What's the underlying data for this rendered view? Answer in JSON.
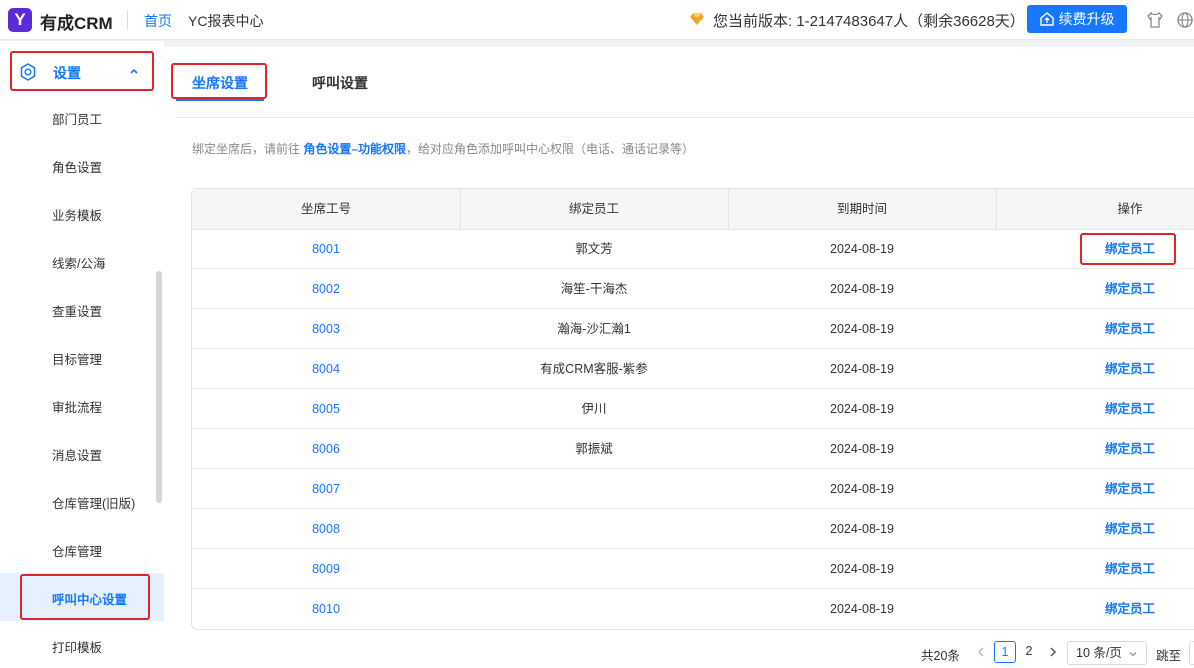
{
  "header": {
    "logo_letter": "Y",
    "brand": "有成CRM",
    "nav_home": "首页",
    "nav_report": "YC报表中心",
    "version_text": "您当前版本: 1-2147483647人（剩余36628天）",
    "upgrade_label": "续费升级",
    "accent": "#1677ff"
  },
  "sidebar": {
    "section_label": "设置",
    "items": [
      "部门员工",
      "角色设置",
      "业务模板",
      "线索/公海",
      "查重设置",
      "目标管理",
      "审批流程",
      "消息设置",
      "仓库管理(旧版)",
      "仓库管理",
      "呼叫中心设置",
      "打印模板"
    ],
    "active_item": "呼叫中心设置"
  },
  "tabs": {
    "seat": "坐席设置",
    "call": "呼叫设置"
  },
  "hint": {
    "prefix": "绑定坐席后，请前往",
    "link": "角色设置–功能权限",
    "suffix": "，给对应角色添加呼叫中心权限（电话、通话记录等）"
  },
  "table": {
    "headers": [
      "坐席工号",
      "绑定员工",
      "到期时间",
      "操作"
    ],
    "rows": [
      {
        "id": "8001",
        "employee": "郭文芳",
        "expire": "2024-08-19",
        "action": "绑定员工"
      },
      {
        "id": "8002",
        "employee": "海笙-干海杰",
        "expire": "2024-08-19",
        "action": "绑定员工"
      },
      {
        "id": "8003",
        "employee": "瀚海-沙汇瀚1",
        "expire": "2024-08-19",
        "action": "绑定员工"
      },
      {
        "id": "8004",
        "employee": "有成CRM客服-紫参",
        "expire": "2024-08-19",
        "action": "绑定员工"
      },
      {
        "id": "8005",
        "employee": "伊川",
        "expire": "2024-08-19",
        "action": "绑定员工"
      },
      {
        "id": "8006",
        "employee": "郭振斌",
        "expire": "2024-08-19",
        "action": "绑定员工"
      },
      {
        "id": "8007",
        "employee": "",
        "expire": "2024-08-19",
        "action": "绑定员工"
      },
      {
        "id": "8008",
        "employee": "",
        "expire": "2024-08-19",
        "action": "绑定员工"
      },
      {
        "id": "8009",
        "employee": "",
        "expire": "2024-08-19",
        "action": "绑定员工"
      },
      {
        "id": "8010",
        "employee": "",
        "expire": "2024-08-19",
        "action": "绑定员工"
      }
    ]
  },
  "pagination": {
    "total": "共20条",
    "pages": [
      "1",
      "2"
    ],
    "current": "1",
    "page_size": "10 条/页",
    "jump_label": "跳至"
  }
}
